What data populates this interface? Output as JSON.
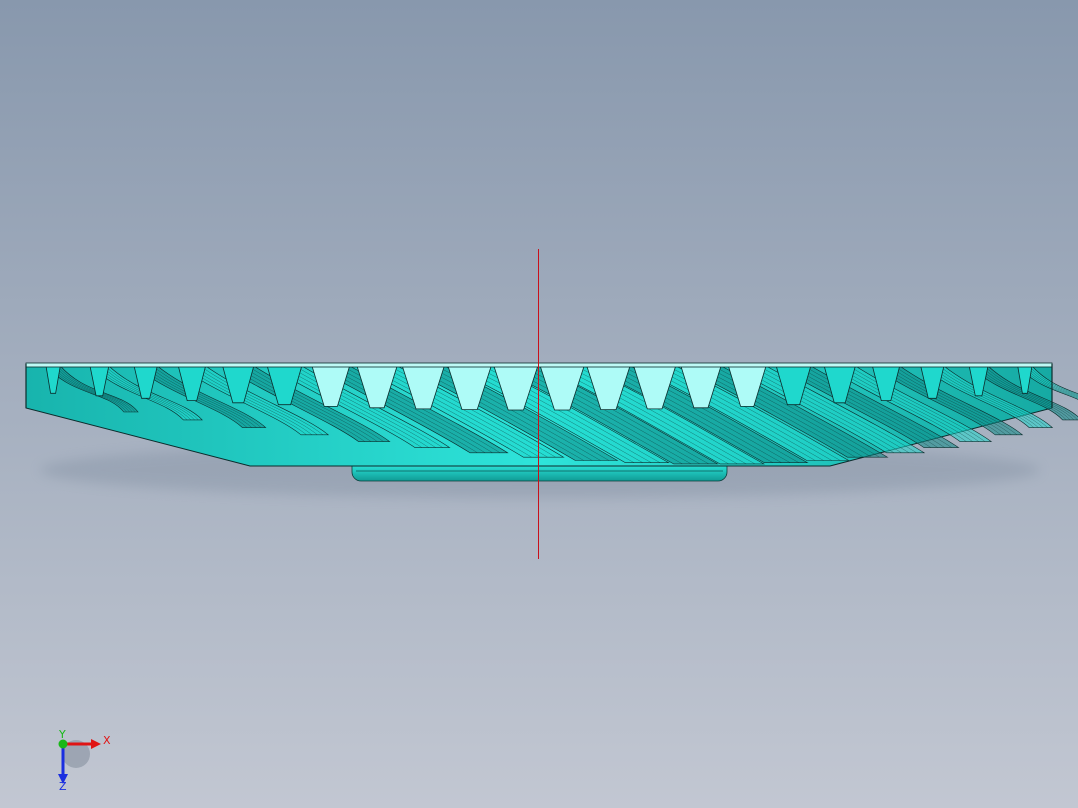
{
  "viewport": {
    "background_top": "#8898ad",
    "background_bottom": "#c2c7d2"
  },
  "model": {
    "part": "spiral-bevel-gear",
    "face_color": "#1fd8cd",
    "face_highlight": "#aefbf7",
    "face_shadow": "#0c8b86",
    "edge_color": "#0b2c2c",
    "visible_tooth_count": 22
  },
  "center_axis": {
    "color": "#c8101a"
  },
  "triad": {
    "x_label": "X",
    "y_label": "Y",
    "z_label": "Z",
    "x_color": "#e01414",
    "y_color": "#18b818",
    "z_color": "#1a2ee0"
  }
}
